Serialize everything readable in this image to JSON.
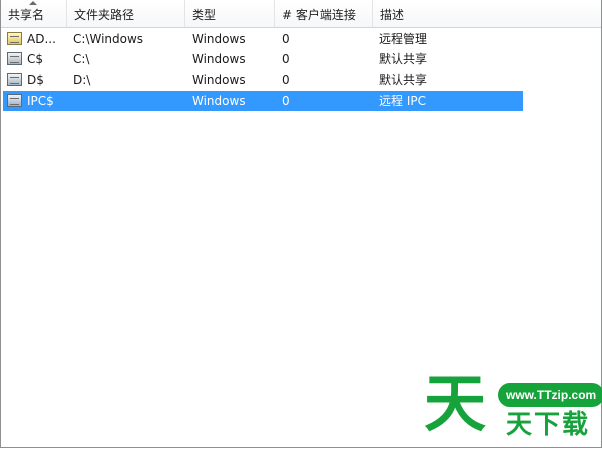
{
  "columns": [
    "共享名",
    "文件夹路径",
    "类型",
    "# 客户端连接",
    "描述"
  ],
  "shares": [
    {
      "name": "AD...",
      "path": "C:\\Windows",
      "type": "Windows",
      "connections": "0",
      "description": "远程管理",
      "icon": "shared-folder-icon"
    },
    {
      "name": "C$",
      "path": "C:\\",
      "type": "Windows",
      "connections": "0",
      "description": "默认共享",
      "icon": "shared-drive-icon"
    },
    {
      "name": "D$",
      "path": "D:\\",
      "type": "Windows",
      "connections": "0",
      "description": "默认共享",
      "icon": "shared-drive-icon"
    },
    {
      "name": "IPC$",
      "path": "",
      "type": "Windows",
      "connections": "0",
      "description": "远程 IPC",
      "icon": "shared-ipc-icon"
    }
  ],
  "selection": {
    "highlight_color": "#3399ff"
  },
  "watermark": {
    "big": "天",
    "url": "www.TTzip.com",
    "sub": "天下载"
  }
}
